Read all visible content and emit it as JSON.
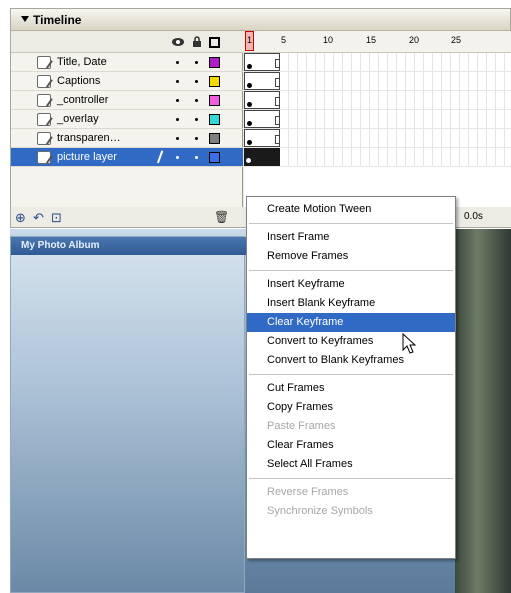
{
  "timeline": {
    "title": "Timeline",
    "elapsed": "0.0s",
    "ruler_numbers": [
      "1",
      "5",
      "10",
      "15",
      "20",
      "25"
    ],
    "layers": [
      {
        "name": "Title, Date",
        "color": "#b01ec8"
      },
      {
        "name": "Captions",
        "color": "#f5d800"
      },
      {
        "name": "_controller",
        "color": "#f05ce0"
      },
      {
        "name": "_overlay",
        "color": "#34d8d8"
      },
      {
        "name": "transparen…",
        "color": "#7f7f7f"
      },
      {
        "name": "picture layer",
        "color": "#3b6fe8"
      }
    ]
  },
  "stage": {
    "window_title": "My Photo Album"
  },
  "context_menu": {
    "items": [
      {
        "label": "Create Motion Tween",
        "state": "enabled"
      },
      {
        "label": "Insert Frame",
        "state": "enabled"
      },
      {
        "label": "Remove Frames",
        "state": "enabled"
      },
      {
        "label": "Insert Keyframe",
        "state": "enabled"
      },
      {
        "label": "Insert Blank Keyframe",
        "state": "enabled"
      },
      {
        "label": "Clear Keyframe",
        "state": "highlighted"
      },
      {
        "label": "Convert to Keyframes",
        "state": "enabled"
      },
      {
        "label": "Convert to Blank Keyframes",
        "state": "enabled"
      },
      {
        "label": "Cut Frames",
        "state": "enabled"
      },
      {
        "label": "Copy Frames",
        "state": "enabled"
      },
      {
        "label": "Paste Frames",
        "state": "disabled"
      },
      {
        "label": "Clear Frames",
        "state": "enabled"
      },
      {
        "label": "Select All Frames",
        "state": "enabled"
      },
      {
        "label": "Reverse Frames",
        "state": "disabled"
      },
      {
        "label": "Synchronize Symbols",
        "state": "disabled"
      }
    ]
  },
  "colors": {
    "selection": "#316ac5",
    "panel": "#ece9d8"
  }
}
